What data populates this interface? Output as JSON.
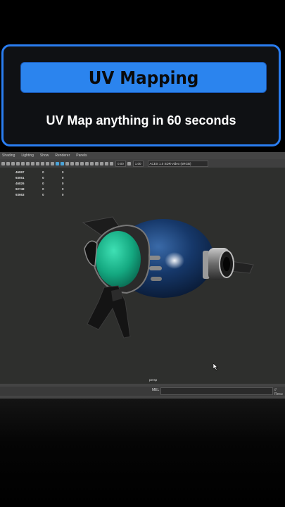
{
  "card": {
    "title": "UV Mapping",
    "subtitle": "UV Map anything in 60 seconds"
  },
  "colors": {
    "accent": "#2a7df0",
    "title_bar": "#2b84ee",
    "viewport_bg": "#2e2f2d",
    "model_body": "#12325c",
    "model_glass": "#16b08a"
  },
  "maya": {
    "menu": [
      "Shading",
      "Lighting",
      "Show",
      "Renderer",
      "Panels"
    ],
    "toolbar": {
      "field1": "0.00",
      "field2": "1.00",
      "color_space": "ACES 1.0 SDR-video (sRGB)"
    },
    "hud": [
      {
        "value": "46997",
        "a": "0",
        "b": "0"
      },
      {
        "value": "93051",
        "a": "0",
        "b": "0"
      },
      {
        "value": "46826",
        "a": "0",
        "b": "0"
      },
      {
        "value": "92748",
        "a": "0",
        "b": "0"
      },
      {
        "value": "93663",
        "a": "0",
        "b": "0"
      }
    ],
    "camera_label": "persp",
    "mel_label": "MEL",
    "result_label": "// Resu"
  },
  "icons": [
    "ray-gun-model-icon",
    "mouse-cursor-icon"
  ]
}
